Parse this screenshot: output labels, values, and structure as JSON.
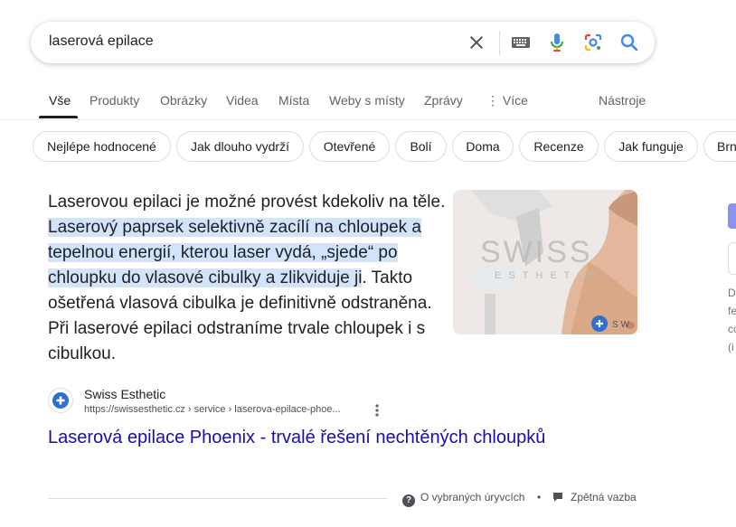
{
  "search": {
    "query": "laserová epilace"
  },
  "tabs": [
    {
      "label": "Vše",
      "active": true
    },
    {
      "label": "Produkty"
    },
    {
      "label": "Obrázky"
    },
    {
      "label": "Videa"
    },
    {
      "label": "Místa"
    },
    {
      "label": "Weby s místy"
    },
    {
      "label": "Zprávy"
    },
    {
      "label": "⋮ Více"
    },
    {
      "label": "Nástroje"
    }
  ],
  "chips": [
    "Nejlépe hodnocené",
    "Jak dlouho vydrží",
    "Otevřené",
    "Bolí",
    "Doma",
    "Recenze",
    "Jak funguje",
    "Brn"
  ],
  "snippet": {
    "part1": "Laserovou epilaci je možné provést kdekoliv na těle. ",
    "highlight": "Laserový paprsek selektivně zacílí na chloupek a tepelnou energií, kterou laser vydá, „sjede“ po chloupku do vlasové cibulky a zlikviduje ji",
    "part2": ". Takto ošetřená vlasová cibulka je definitivně odstraněna. Při laserové epilaci odstraníme trvale chloupek i s cibulkou.",
    "image_watermark": "SWISS",
    "image_watermark_sub": "ESTHETIC"
  },
  "source": {
    "name": "Swiss Esthetic",
    "url": "https://swissesthetic.cz › service › laserova-epilace-phoe...",
    "title": "Laserová epilace Phoenix - trvalé řešení nechtěných chloupků"
  },
  "footer": {
    "about": "O vybraných úryvcích",
    "separator": "•",
    "feedback": "Zpětná vazba"
  },
  "right_panel": {
    "text": "D fe co (i"
  },
  "colors": {
    "link": "#1a0dab",
    "highlight": "#d2e3fc",
    "accent": "#4285f4"
  }
}
